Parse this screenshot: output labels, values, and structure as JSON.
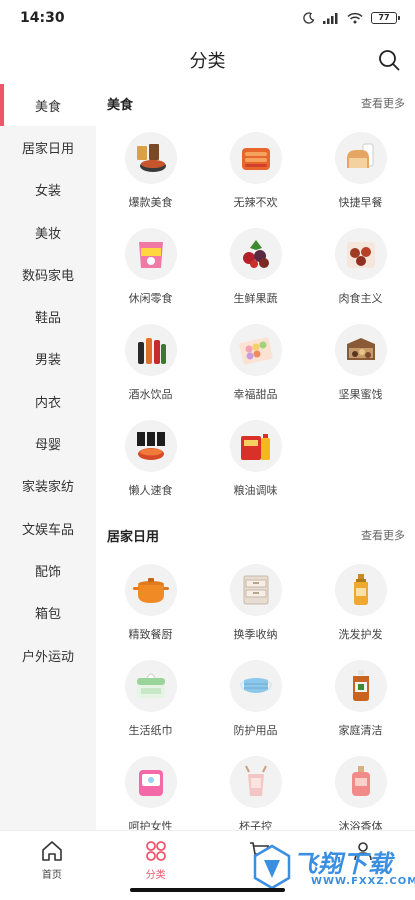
{
  "status_bar": {
    "time": "14:30",
    "battery": "77"
  },
  "header": {
    "title": "分类"
  },
  "sidebar": {
    "items": [
      {
        "label": "美食",
        "active": true
      },
      {
        "label": "居家日用"
      },
      {
        "label": "女装"
      },
      {
        "label": "美妆"
      },
      {
        "label": "数码家电"
      },
      {
        "label": "鞋品"
      },
      {
        "label": "男装"
      },
      {
        "label": "内衣"
      },
      {
        "label": "母婴"
      },
      {
        "label": "家装家纺"
      },
      {
        "label": "文娱车品"
      },
      {
        "label": "配饰"
      },
      {
        "label": "箱包"
      },
      {
        "label": "户外运动"
      }
    ]
  },
  "sections": [
    {
      "title": "美食",
      "more": "查看更多",
      "items": [
        {
          "label": "爆款美食",
          "icon": "food-bowl-icon"
        },
        {
          "label": "无辣不欢",
          "icon": "spicy-snack-icon"
        },
        {
          "label": "快捷早餐",
          "icon": "bread-milk-icon"
        },
        {
          "label": "休闲零食",
          "icon": "snack-bag-icon"
        },
        {
          "label": "生鲜果蔬",
          "icon": "fruit-icon"
        },
        {
          "label": "肉食主义",
          "icon": "meat-icon"
        },
        {
          "label": "酒水饮品",
          "icon": "drinks-icon"
        },
        {
          "label": "幸福甜品",
          "icon": "dessert-icon"
        },
        {
          "label": "坚果蜜饯",
          "icon": "nuts-icon"
        },
        {
          "label": "懒人速食",
          "icon": "instant-noodle-icon"
        },
        {
          "label": "粮油调味",
          "icon": "rice-oil-icon"
        }
      ]
    },
    {
      "title": "居家日用",
      "more": "查看更多",
      "items": [
        {
          "label": "精致餐厨",
          "icon": "pot-icon"
        },
        {
          "label": "换季收纳",
          "icon": "storage-box-icon"
        },
        {
          "label": "洗发护发",
          "icon": "shampoo-icon"
        },
        {
          "label": "生活纸巾",
          "icon": "tissue-icon"
        },
        {
          "label": "防护用品",
          "icon": "mask-icon"
        },
        {
          "label": "家庭清洁",
          "icon": "cleaner-bottle-icon"
        },
        {
          "label": "呵护女性",
          "icon": "pad-icon"
        },
        {
          "label": "杯子控",
          "icon": "cup-icon"
        },
        {
          "label": "沐浴香体",
          "icon": "perfume-icon"
        }
      ]
    }
  ],
  "tabbar": {
    "tabs": [
      {
        "label": "首页",
        "icon": "home-icon"
      },
      {
        "label": "分类",
        "icon": "category-icon",
        "active": true
      },
      {
        "label": "",
        "icon": "cart-icon"
      },
      {
        "label": "",
        "icon": "profile-icon"
      }
    ]
  },
  "watermark": {
    "title": "飞翔下载",
    "sub": "WWW.FXXZ.COM"
  },
  "colors": {
    "accent": "#f0566a",
    "sidebar_bg": "#f5f5f5",
    "watermark": "#3b8fe0"
  }
}
